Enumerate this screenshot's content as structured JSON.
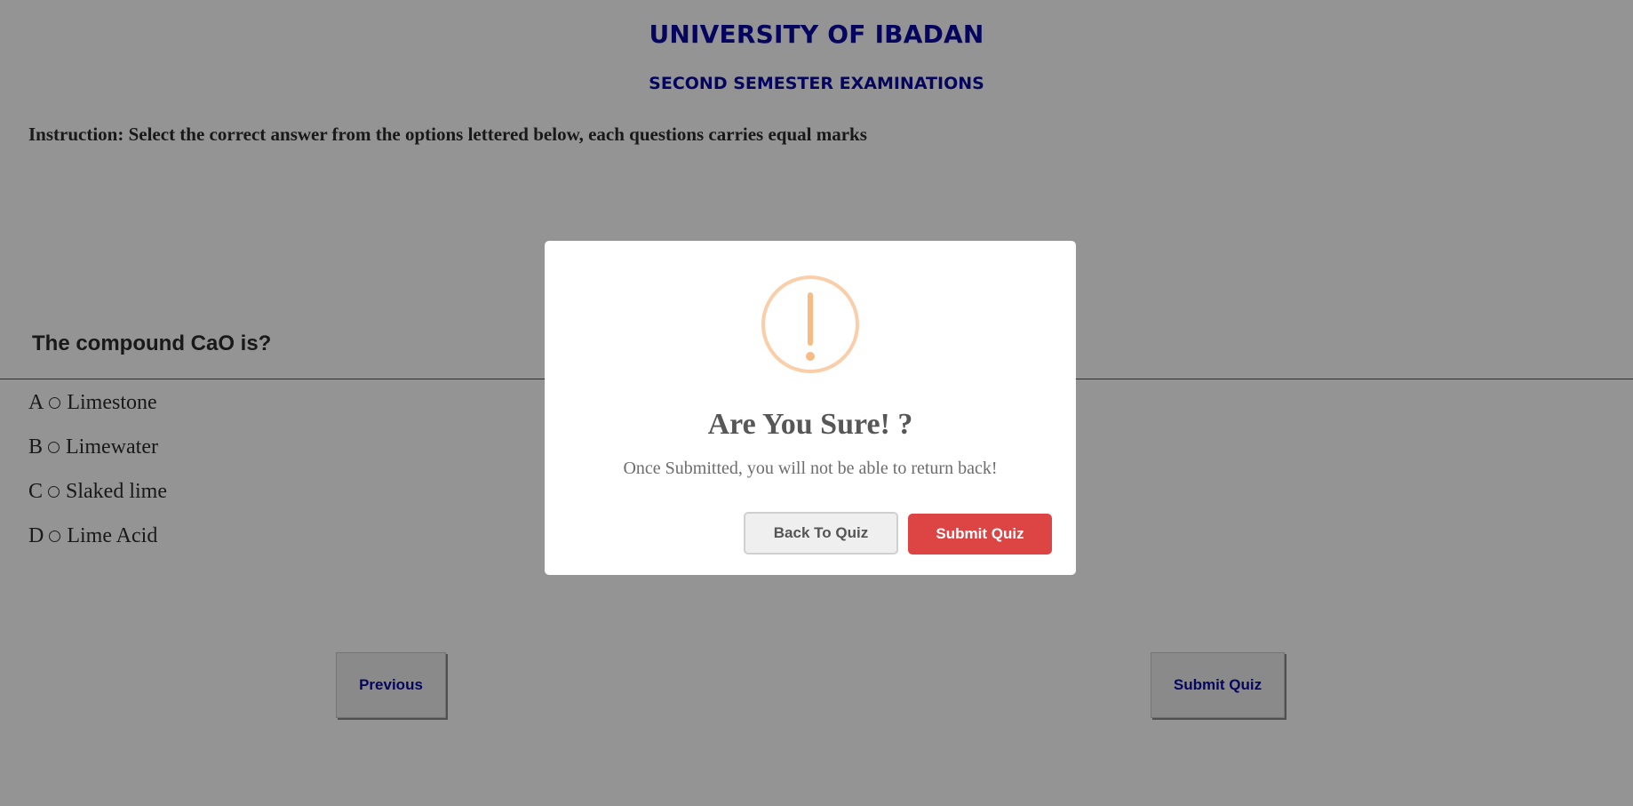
{
  "header": {
    "university": "UNIVERSITY OF IBADAN",
    "exam": "SECOND SEMESTER EXAMINATIONS"
  },
  "instruction": "Instruction: Select the correct answer from the options lettered below, each questions carries equal marks",
  "question": {
    "text": "The compound CaO is?",
    "options": [
      {
        "letter": "A",
        "label": "Limestone"
      },
      {
        "letter": "B",
        "label": "Limewater"
      },
      {
        "letter": "C",
        "label": "Slaked lime"
      },
      {
        "letter": "D",
        "label": "Lime Acid"
      }
    ]
  },
  "nav": {
    "previous_label": "Previous",
    "submit_label": "Submit Quiz"
  },
  "modal": {
    "icon": "warning-exclamation-icon",
    "title": "Are You Sure! ?",
    "text": "Once Submitted, you will not be able to return back!",
    "back_label": "Back To Quiz",
    "submit_label": "Submit Quiz"
  },
  "colors": {
    "header": "#0a0aa6",
    "submit_button": "#dd4444",
    "warning_icon": "#f8bb86"
  }
}
